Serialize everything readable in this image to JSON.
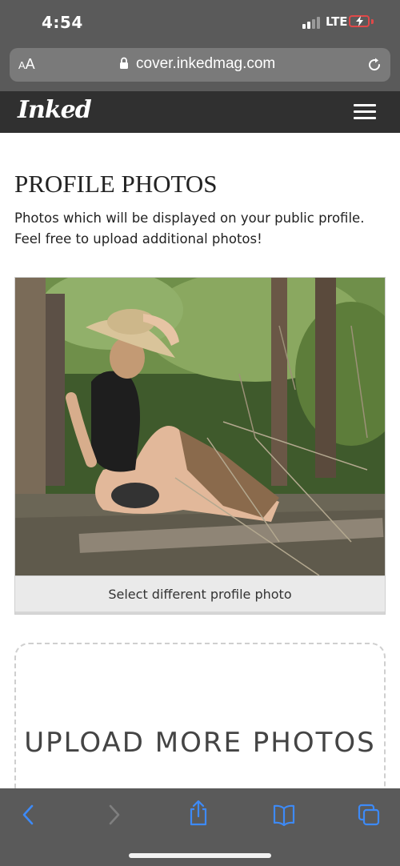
{
  "status": {
    "time": "4:54",
    "network": "LTE"
  },
  "browser": {
    "text_size_label": "AA",
    "url": "cover.inkedmag.com"
  },
  "site": {
    "logo": "Inked"
  },
  "profile_photos": {
    "title": "PROFILE PHOTOS",
    "description": "Photos which will be displayed on your public profile. Feel free to upload additional photos!",
    "select_button": "Select different profile photo"
  },
  "upload": {
    "title": "UPLOAD MORE PHOTOS"
  },
  "colors": {
    "browser_chrome": "#5a5a5a",
    "site_header": "#303030",
    "toolbar_accent": "#3d8af7"
  }
}
